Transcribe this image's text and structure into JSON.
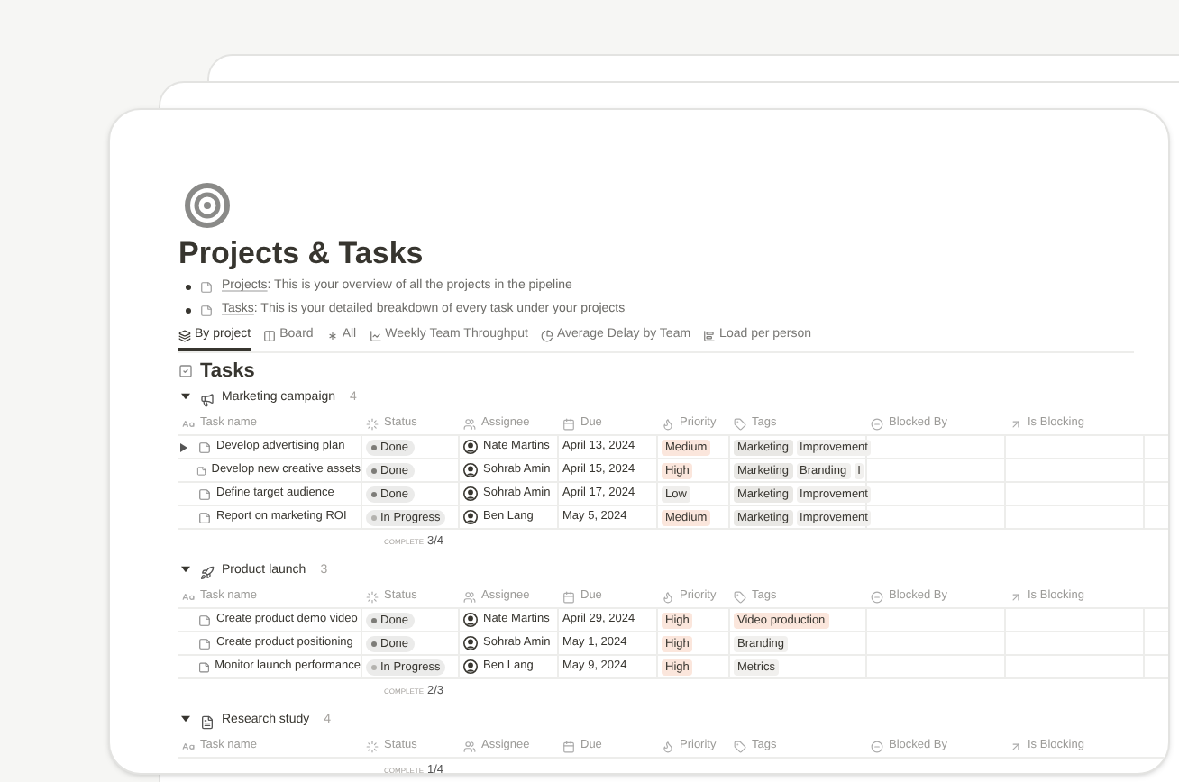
{
  "page": {
    "title": "Projects & Tasks"
  },
  "bullets": [
    {
      "link": "Projects",
      "text": ": This is your overview of all the projects in the pipeline"
    },
    {
      "link": "Tasks",
      "text": ": This is your detailed breakdown of every task under your projects"
    }
  ],
  "view_tabs": [
    {
      "label": "By project",
      "selected": true
    },
    {
      "label": "Board",
      "selected": false
    },
    {
      "label": "All",
      "selected": false
    },
    {
      "label": "Weekly Team Throughput",
      "selected": false
    },
    {
      "label": "Average Delay by Team",
      "selected": false
    },
    {
      "label": "Load per person",
      "selected": false
    }
  ],
  "database": {
    "title": "Tasks",
    "groups": [
      {
        "name": "Marketing campaign",
        "count": "4",
        "expanded": true,
        "columns": [
          "Task name",
          "Status",
          "Assignee",
          "Due",
          "Priority",
          "Tags",
          "Blocked By",
          "Is Blocking"
        ],
        "complete_label": "COMPLETE",
        "complete": "3/4",
        "rows": [
          {
            "task": "Develop advertising plan",
            "hovered": true,
            "status": {
              "label": "Done",
              "color": "#7d7c78"
            },
            "assignee": "Nate Martins",
            "due": "April 13, 2024",
            "priority": {
              "label": "Medium",
              "color": "#fbe6dc"
            },
            "tags": [
              {
                "label": "Marketing",
                "color": "#e9e8e5"
              },
              {
                "label": "Improvement",
                "color": "#f1f0ee"
              }
            ]
          },
          {
            "task": "Develop new creative assets",
            "hovered": false,
            "status": {
              "label": "Done",
              "color": "#7d7c78"
            },
            "assignee": "Sohrab Amin",
            "due": "April 15, 2024",
            "priority": {
              "label": "High",
              "color": "#fbe6dc"
            },
            "tags": [
              {
                "label": "Marketing",
                "color": "#e9e8e5"
              },
              {
                "label": "Branding",
                "color": "#f1f0ee"
              },
              {
                "label": "I",
                "color": "#f1f0ee"
              }
            ]
          },
          {
            "task": "Define target audience",
            "hovered": false,
            "status": {
              "label": "Done",
              "color": "#7d7c78"
            },
            "assignee": "Sohrab Amin",
            "due": "April 17, 2024",
            "priority": {
              "label": "Low",
              "color": "#efeeec"
            },
            "tags": [
              {
                "label": "Marketing",
                "color": "#e9e8e5"
              },
              {
                "label": "Improvement",
                "color": "#f1f0ee"
              }
            ]
          },
          {
            "task": "Report on marketing ROI",
            "hovered": false,
            "status": {
              "label": "In Progress",
              "color": "#b4b3af"
            },
            "assignee": "Ben Lang",
            "due": "May 5, 2024",
            "priority": {
              "label": "Medium",
              "color": "#fbe6dc"
            },
            "tags": [
              {
                "label": "Marketing",
                "color": "#e9e8e5"
              },
              {
                "label": "Improvement",
                "color": "#f1f0ee"
              }
            ]
          }
        ]
      },
      {
        "name": "Product launch",
        "count": "3",
        "expanded": true,
        "columns": [
          "Task name",
          "Status",
          "Assignee",
          "Due",
          "Priority",
          "Tags",
          "Blocked By",
          "Is Blocking"
        ],
        "complete_label": "COMPLETE",
        "complete": "2/3",
        "rows": [
          {
            "task": "Create product demo video",
            "hovered": false,
            "status": {
              "label": "Done",
              "color": "#7d7c78"
            },
            "assignee": "Nate Martins",
            "due": "April 29, 2024",
            "priority": {
              "label": "High",
              "color": "#fbe6dc"
            },
            "tags": [
              {
                "label": "Video production",
                "color": "#fbe6dc"
              }
            ]
          },
          {
            "task": "Create product positioning",
            "hovered": false,
            "status": {
              "label": "Done",
              "color": "#7d7c78"
            },
            "assignee": "Sohrab Amin",
            "due": "May 1, 2024",
            "priority": {
              "label": "High",
              "color": "#fbe6dc"
            },
            "tags": [
              {
                "label": "Branding",
                "color": "#f1f0ee"
              }
            ]
          },
          {
            "task": "Monitor launch performance",
            "hovered": false,
            "status": {
              "label": "In Progress",
              "color": "#b4b3af"
            },
            "assignee": "Ben Lang",
            "due": "May 9, 2024",
            "priority": {
              "label": "High",
              "color": "#fbe6dc"
            },
            "tags": [
              {
                "label": "Metrics",
                "color": "#f1f0ee"
              }
            ]
          }
        ]
      },
      {
        "name": "Research study",
        "count": "4",
        "expanded": true,
        "columns": [
          "Task name",
          "Status",
          "Assignee",
          "Due",
          "Priority",
          "Tags",
          "Blocked By",
          "Is Blocking"
        ],
        "complete_label": "COMPLETE",
        "complete": "1/4"
      }
    ]
  }
}
